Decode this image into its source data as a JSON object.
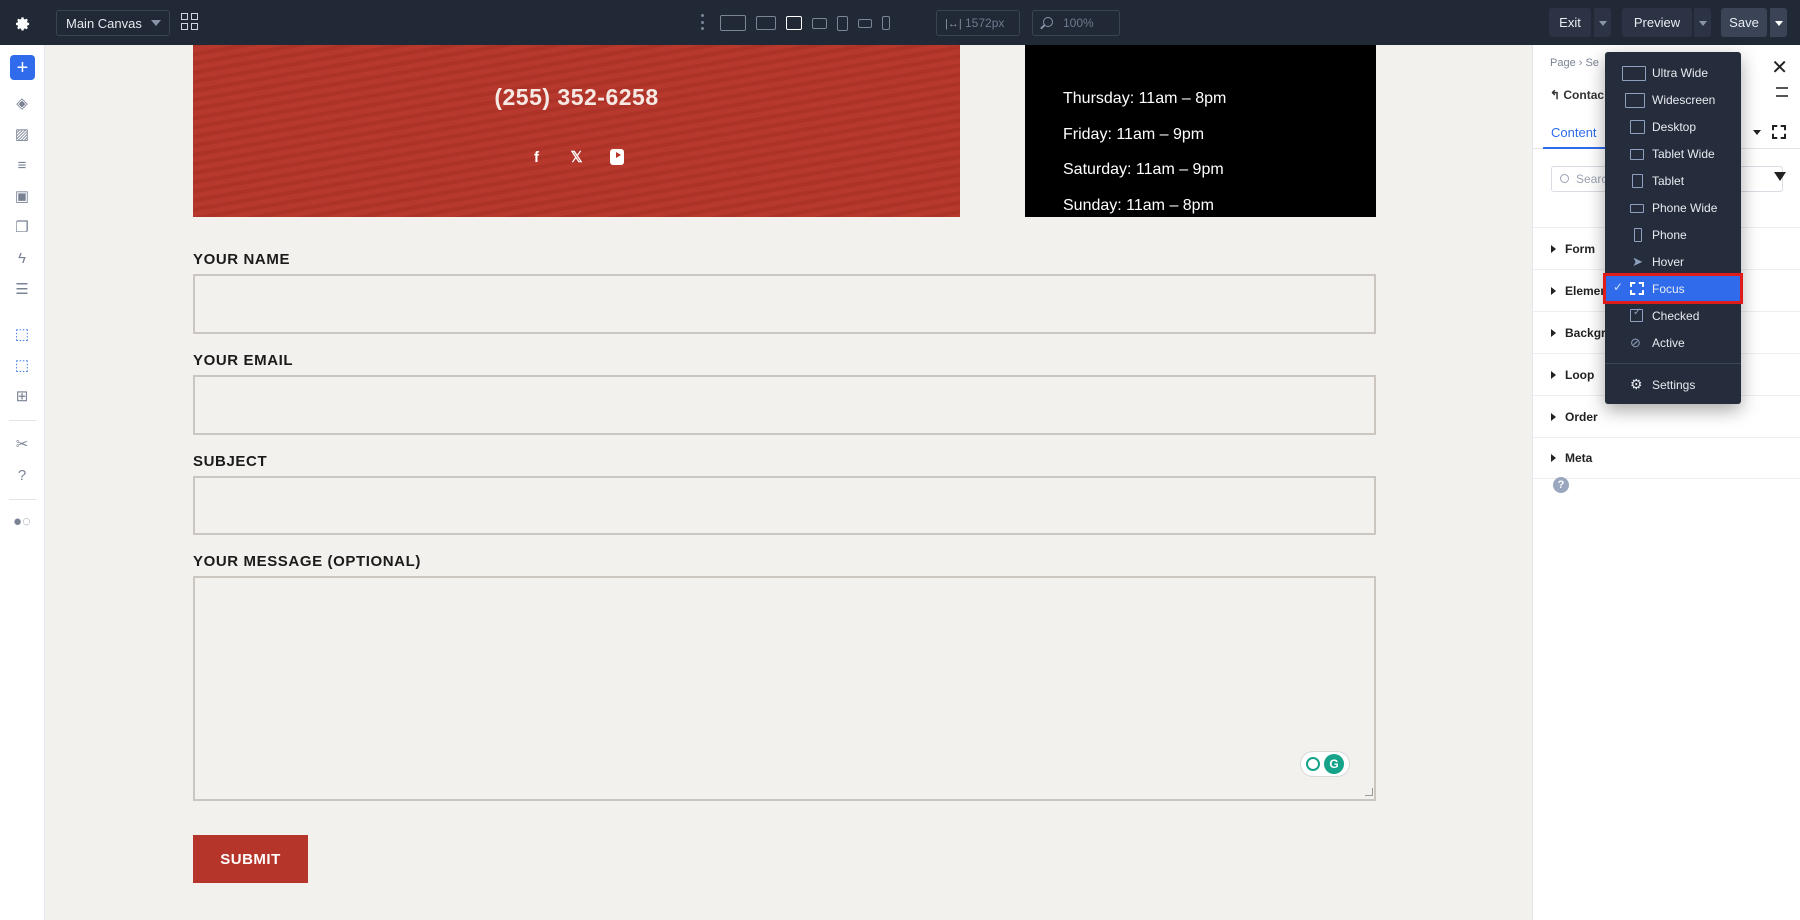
{
  "topbar": {
    "canvas_select": "Main Canvas",
    "width_value": "1572px",
    "zoom_value": "100%",
    "exit_label": "Exit",
    "preview_label": "Preview",
    "save_label": "Save"
  },
  "canvas": {
    "phone": "(255) 352-6258",
    "hours": [
      "Thursday: 11am – 8pm",
      "Friday: 11am – 9pm",
      "Saturday: 11am – 9pm",
      "Sunday: 11am – 8pm"
    ],
    "form": {
      "name_label": "YOUR NAME",
      "email_label": "YOUR EMAIL",
      "subject_label": "SUBJECT",
      "message_label": "YOUR MESSAGE (OPTIONAL)",
      "submit_label": "SUBMIT"
    }
  },
  "panel": {
    "breadcrumb": "Page › Se",
    "context_title": "Contac",
    "tab_content": "Content",
    "search_placeholder": "Searc",
    "sections": [
      "Form",
      "Elemen",
      "Backgr",
      "Loop",
      "Order",
      "Meta"
    ]
  },
  "menu": {
    "items": [
      {
        "label": "Ultra Wide",
        "icon": "ultra-wide-icon"
      },
      {
        "label": "Widescreen",
        "icon": "widescreen-icon"
      },
      {
        "label": "Desktop",
        "icon": "desktop-icon"
      },
      {
        "label": "Tablet Wide",
        "icon": "tablet-wide-icon"
      },
      {
        "label": "Tablet",
        "icon": "tablet-icon"
      },
      {
        "label": "Phone Wide",
        "icon": "phone-wide-icon"
      },
      {
        "label": "Phone",
        "icon": "phone-icon"
      },
      {
        "label": "Hover",
        "icon": "cursor-icon"
      },
      {
        "label": "Focus",
        "icon": "focus-icon",
        "selected": true
      },
      {
        "label": "Checked",
        "icon": "checkbox-icon"
      },
      {
        "label": "Active",
        "icon": "active-icon"
      },
      {
        "label": "Settings",
        "icon": "gear-icon"
      }
    ]
  },
  "colors": {
    "topbar_bg": "#212836",
    "accent": "#2f6bea",
    "brand_red": "#b6352a",
    "highlight_outline": "#e01b1b"
  }
}
